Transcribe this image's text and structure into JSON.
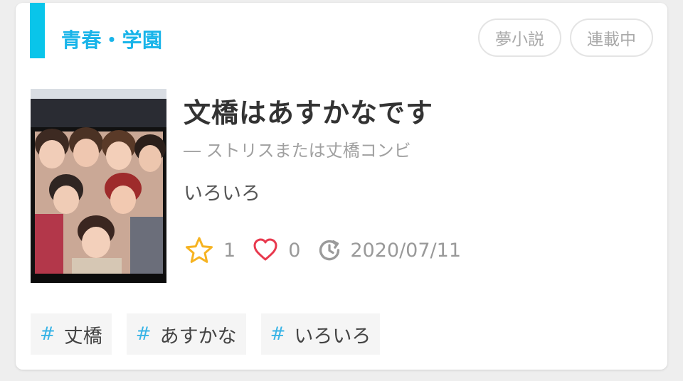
{
  "colors": {
    "accent": "#09c5ea",
    "genre_text": "#18b4e9",
    "star": "#f6b321",
    "heart": "#e8394e",
    "tag_hash": "#39b4e6"
  },
  "genre": {
    "label": "青春・学園"
  },
  "badges": [
    {
      "label": "夢小説"
    },
    {
      "label": "連載中"
    }
  ],
  "story": {
    "title": "文橋はあすかなです",
    "subtitle": "― ストリスまたは丈橋コンビ",
    "description": "いろいろ"
  },
  "stats": {
    "stars": "1",
    "hearts": "0",
    "updated": "2020/07/11",
    "icons": [
      "star-icon",
      "heart-icon",
      "history-clock-icon"
    ]
  },
  "tags": [
    {
      "hash": "#",
      "label": "丈橋"
    },
    {
      "hash": "#",
      "label": "あすかな"
    },
    {
      "hash": "#",
      "label": "いろいろ"
    }
  ]
}
